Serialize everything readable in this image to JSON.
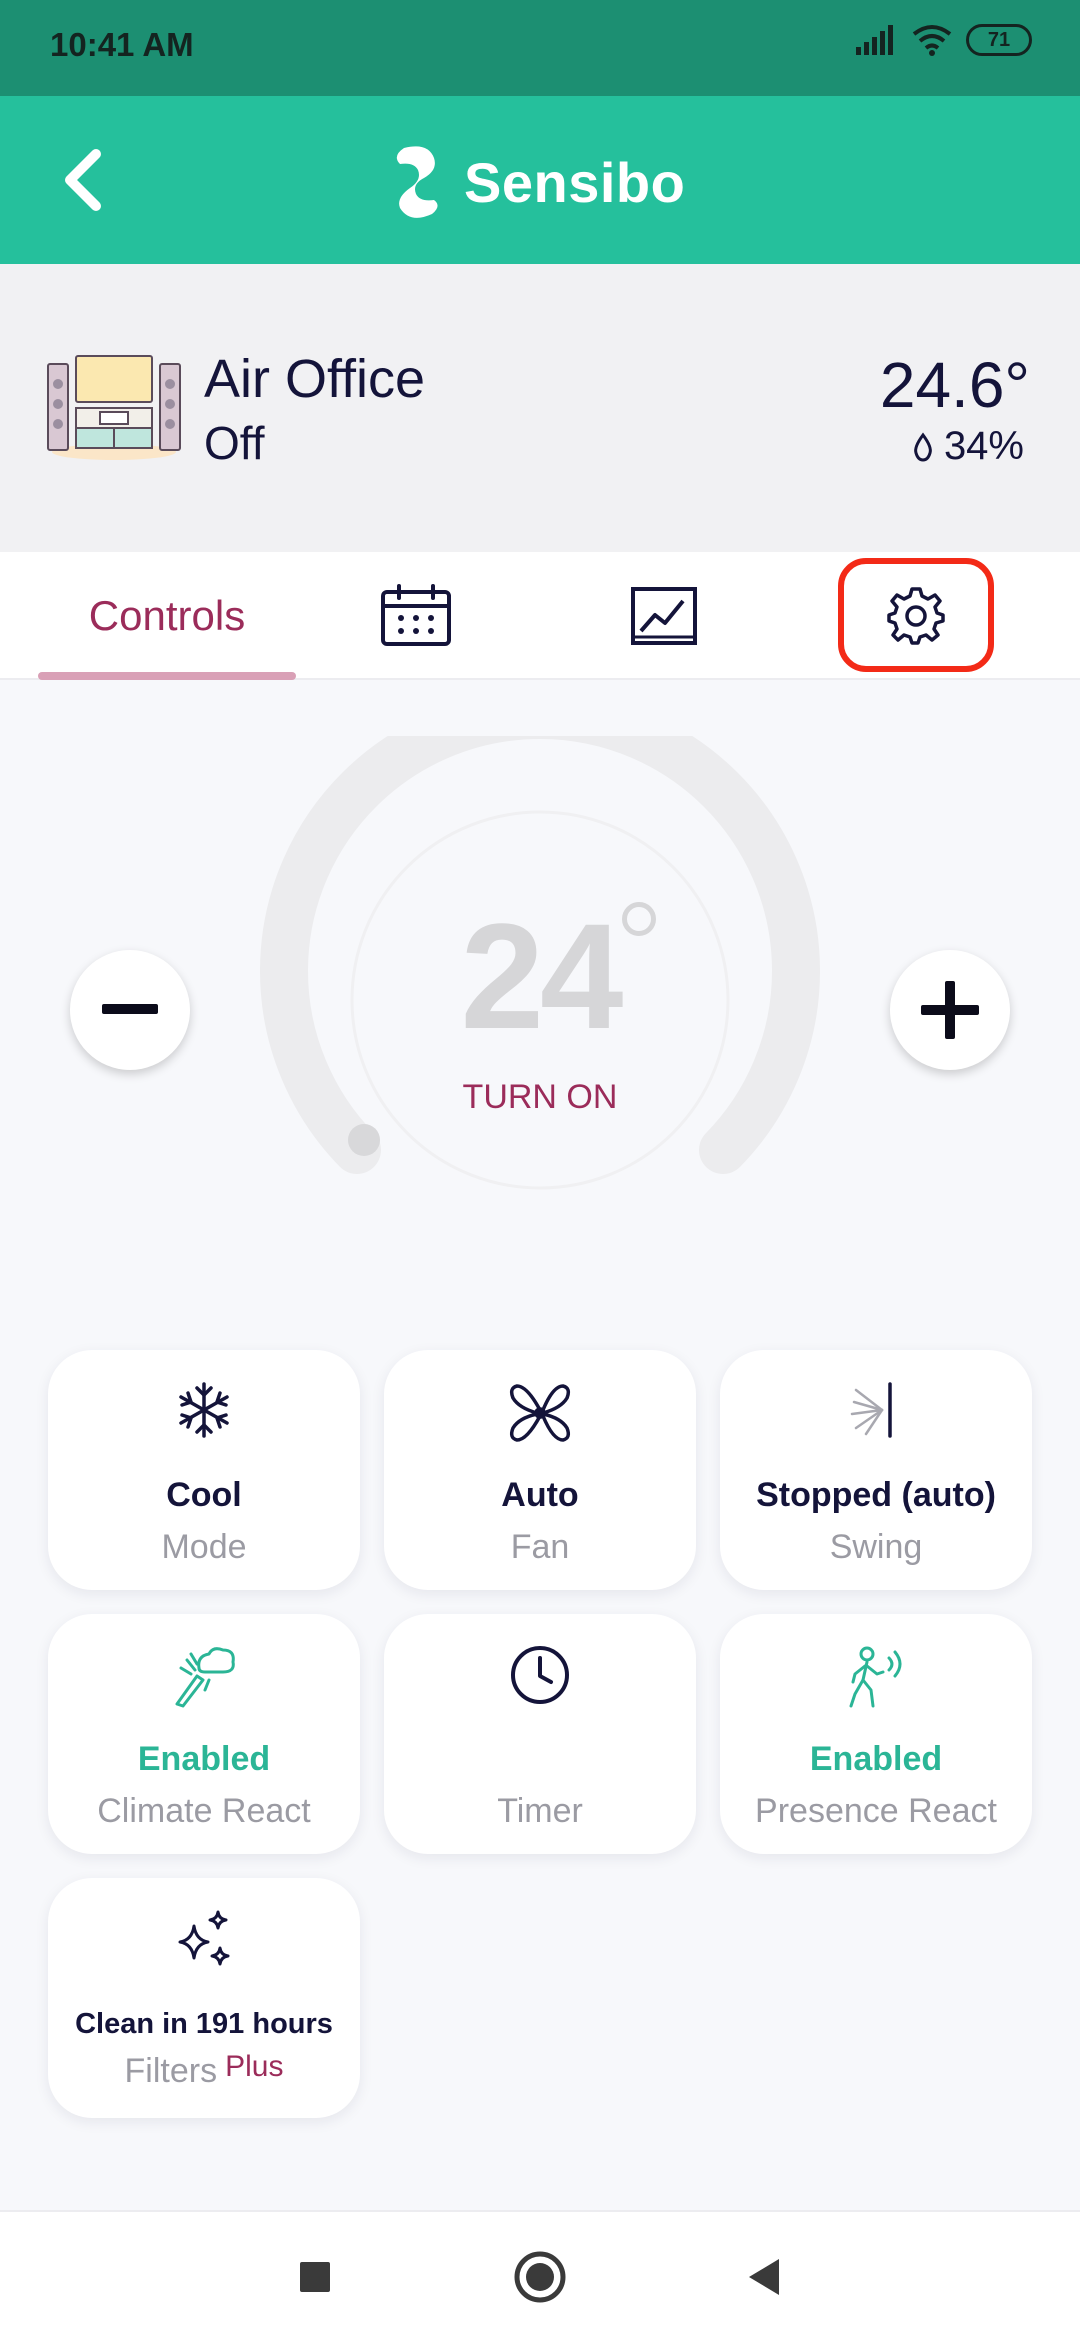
{
  "status_bar": {
    "time": "10:41 AM",
    "battery": "71",
    "icons": [
      "signal-icon",
      "wifi-icon",
      "battery-icon"
    ]
  },
  "app_bar": {
    "brand": "Sensibo",
    "back_icon": "chevron-left-icon",
    "logo_icon": "sensibo-logo-icon"
  },
  "device": {
    "name": "Air Office",
    "state": "Off",
    "room_temperature": "24.6°",
    "humidity": "34%"
  },
  "tabs": [
    {
      "label": "Controls",
      "icon": null,
      "active": true
    },
    {
      "label": "",
      "icon": "calendar-icon",
      "active": false
    },
    {
      "label": "",
      "icon": "chart-icon",
      "active": false
    },
    {
      "label": "",
      "icon": "gear-icon",
      "active": false,
      "highlighted": true
    }
  ],
  "thermostat": {
    "target_temperature": "24",
    "power_action": "TURN ON"
  },
  "cards": {
    "mode": {
      "value": "Cool",
      "label": "Mode",
      "icon": "snowflake-icon"
    },
    "fan": {
      "value": "Auto",
      "label": "Fan",
      "icon": "fan-icon"
    },
    "swing": {
      "value": "Stopped (auto)",
      "label": "Swing",
      "icon": "swing-icon"
    },
    "climate_react": {
      "value": "Enabled",
      "label": "Climate React",
      "icon": "climate-react-icon"
    },
    "timer": {
      "value": "",
      "label": "Timer",
      "icon": "clock-icon"
    },
    "presence_react": {
      "value": "Enabled",
      "label": "Presence React",
      "icon": "presence-icon"
    },
    "filters": {
      "value": "Clean in 191 hours",
      "label": "Filters",
      "badge": "Plus",
      "icon": "sparkle-icon"
    }
  },
  "colors": {
    "status_bar": "#1c8f72",
    "app_bar": "#25c09c",
    "accent": "#9b2c5a",
    "enabled_green": "#2bb596",
    "highlight_red": "#f32a17"
  },
  "nav_bar": {
    "icons": [
      "recent-apps-icon",
      "home-icon",
      "back-icon"
    ]
  }
}
